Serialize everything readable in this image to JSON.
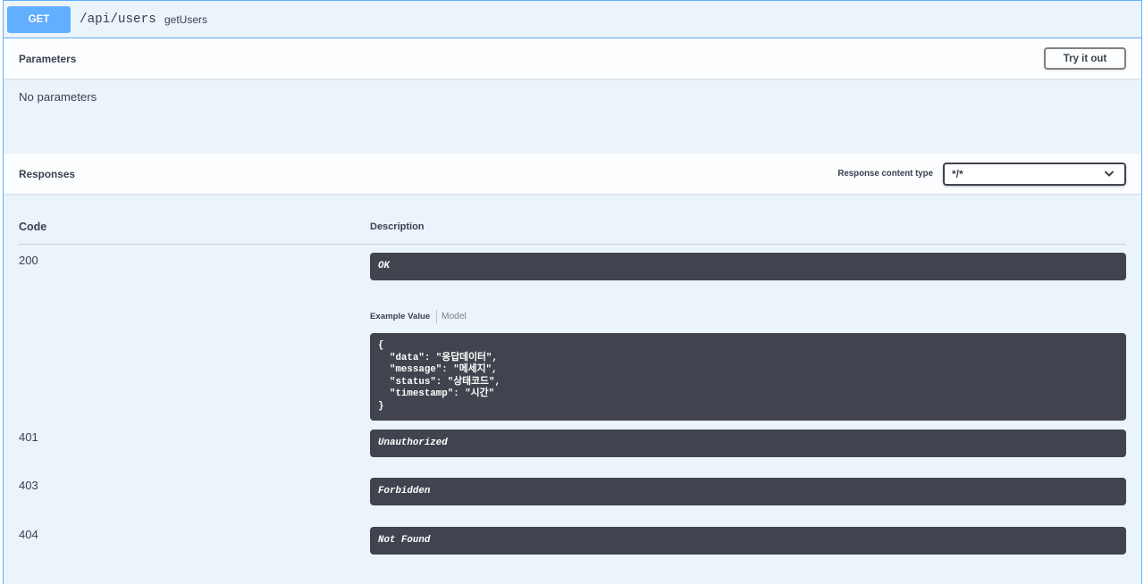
{
  "operation": {
    "method": "GET",
    "path": "/api/users",
    "operation_id": "getUsers"
  },
  "parameters": {
    "title": "Parameters",
    "try_it_out_label": "Try it out",
    "empty_text": "No parameters"
  },
  "responses": {
    "title": "Responses",
    "content_type_label": "Response content type",
    "content_type_value": "*/*",
    "columns": {
      "code": "Code",
      "description": "Description"
    },
    "rows": [
      {
        "code": "200",
        "description": "OK",
        "example_tabs": [
          {
            "label": "Example Value",
            "active": true
          },
          {
            "label": "Model",
            "active": false
          }
        ],
        "example_value": "{\n  \"data\": \"응답데이터\",\n  \"message\": \"메세지\",\n  \"status\": \"상태코드\",\n  \"timestamp\": \"시간\"\n}"
      },
      {
        "code": "401",
        "description": "Unauthorized"
      },
      {
        "code": "403",
        "description": "Forbidden"
      },
      {
        "code": "404",
        "description": "Not Found"
      }
    ]
  },
  "icons": {
    "content_type_select": "chevron-down-icon"
  },
  "colors": {
    "get_method": "#61affe",
    "block_background": "#ebf3fb",
    "text": "#3b4151",
    "response_box": "#41444e",
    "response_box_text": "#ffffff"
  }
}
